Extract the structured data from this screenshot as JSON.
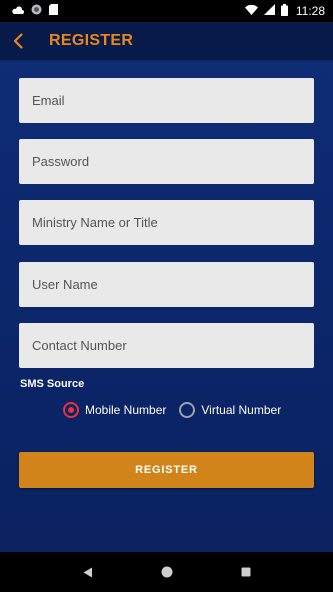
{
  "status_bar": {
    "time": "11:28",
    "left_icons": [
      "cloud-icon",
      "circle-app-icon",
      "sd-card-icon"
    ],
    "right_icons": [
      "wifi-icon",
      "signal-icon",
      "battery-icon"
    ]
  },
  "app_bar": {
    "title": "REGISTER",
    "back_icon": "chevron-left-icon",
    "accent_color": "#e8871e"
  },
  "form": {
    "email": {
      "placeholder": "Email",
      "value": ""
    },
    "password": {
      "placeholder": "Password",
      "value": ""
    },
    "ministry": {
      "placeholder": "Ministry Name or Title",
      "value": ""
    },
    "username": {
      "placeholder": "User Name",
      "value": ""
    },
    "contact": {
      "placeholder": "Contact Number",
      "value": ""
    },
    "sms_source_label": "SMS Source",
    "sms_options": [
      {
        "label": "Mobile Number",
        "selected": true
      },
      {
        "label": "Virtual Number",
        "selected": false
      }
    ],
    "register_button": "REGISTER"
  },
  "colors": {
    "background": "#0d2a6b",
    "button": "#d1841a",
    "radio_selected": "#e8323c"
  },
  "nav_bar": {
    "icons": [
      "back-triangle-icon",
      "home-circle-icon",
      "recents-square-icon"
    ]
  }
}
